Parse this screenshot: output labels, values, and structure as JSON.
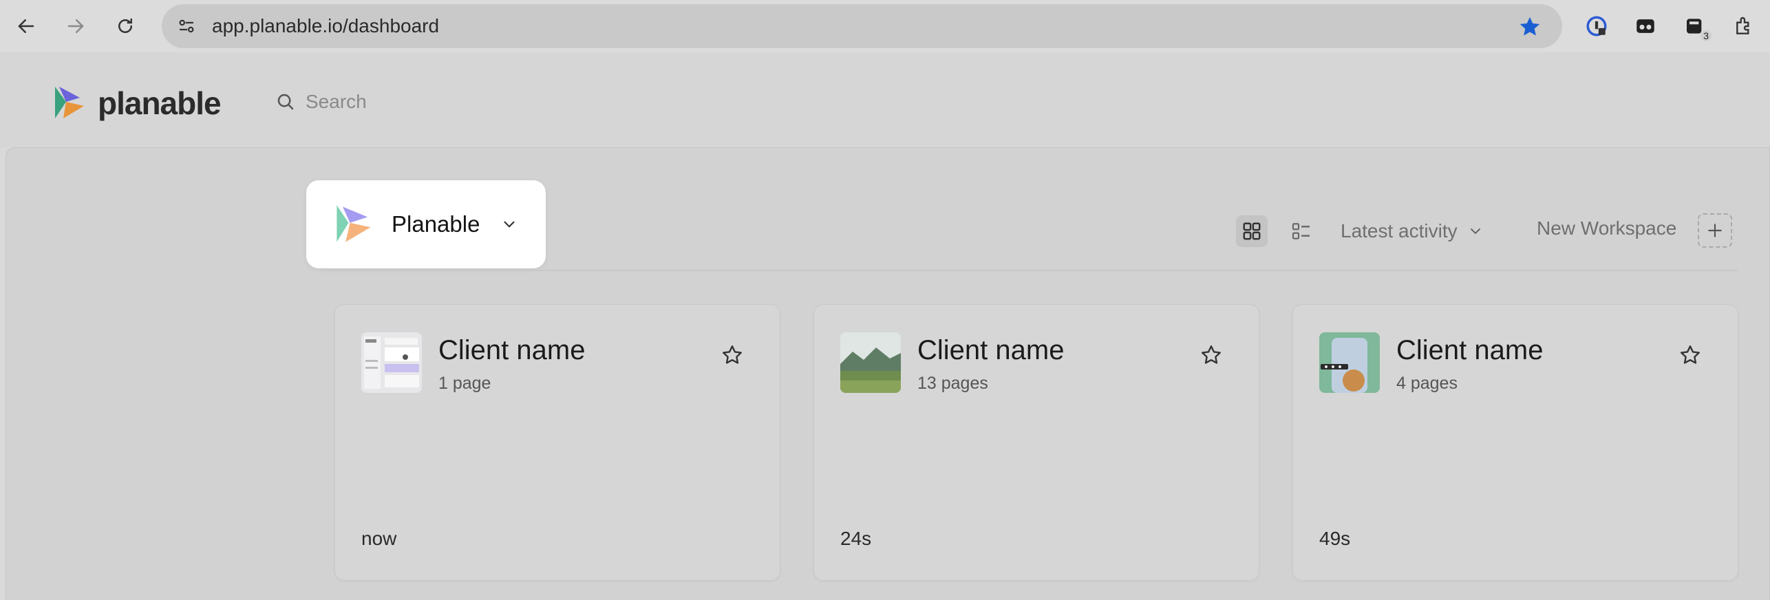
{
  "browser": {
    "url": "app.planable.io/dashboard",
    "extension_badge": "3",
    "colors": {
      "bookmark_star": "#1a5fd1"
    }
  },
  "app": {
    "logo_text": "planable",
    "search_placeholder": "Search"
  },
  "workspace": {
    "name": "Planable"
  },
  "toolbar": {
    "sort_label": "Latest activity",
    "new_workspace_label": "New Workspace"
  },
  "cards": [
    {
      "title": "Client name",
      "subtitle": "1 page",
      "time": "now",
      "thumb": "dashboard-screenshot"
    },
    {
      "title": "Client name",
      "subtitle": "13 pages",
      "time": "24s",
      "thumb": "landscape-photo"
    },
    {
      "title": "Client name",
      "subtitle": "4 pages",
      "time": "49s",
      "thumb": "phone-mockup"
    }
  ]
}
